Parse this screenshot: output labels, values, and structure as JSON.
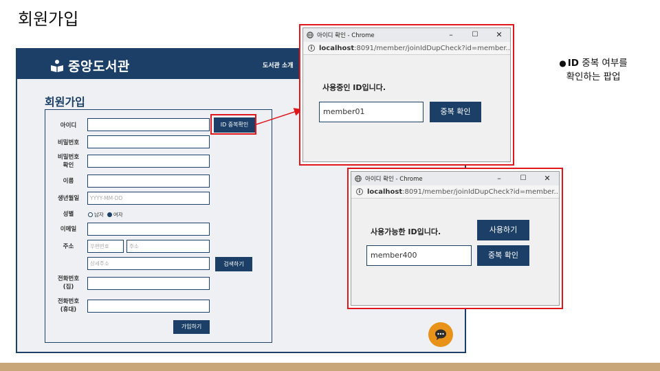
{
  "slide": {
    "title": "회원가입",
    "note_bold": "ID",
    "note_line1": "중복 여부를",
    "note_line2": "확인하는 팝업"
  },
  "site": {
    "logo_text": "중앙도서관",
    "nav_link": "도서관 소개",
    "form_title": "회원가입",
    "fields": {
      "id_label": "아이디",
      "pw_label": "비밀번호",
      "pw_confirm_label_1": "비밀번호",
      "pw_confirm_label_2": "확인",
      "name_label": "이름",
      "birth_label": "생년월일",
      "birth_placeholder": "YYYY-MM-DD",
      "gender_label": "성별",
      "gender_male": "남자",
      "gender_female": "여자",
      "gender_selected": "여자",
      "email_label": "이메일",
      "addr_label": "주소",
      "zip_placeholder": "우편번호",
      "addr_placeholder": "주소",
      "addr_detail_placeholder": "상세주소",
      "tel_home_label_1": "전화번호",
      "tel_home_label_2": "(집)",
      "tel_mobile_label_1": "전화번호",
      "tel_mobile_label_2": "(휴대)"
    },
    "buttons": {
      "dup_check": "ID 중복확인",
      "search": "검색하기",
      "join": "가입하기"
    }
  },
  "popups": [
    {
      "title": "아이디 확인 - Chrome",
      "url_host": "localhost",
      "url_rest": ":8091/member/joinIdDupCheck?id=member...",
      "message": "사용중인 ID입니다.",
      "input_value": "member01",
      "check_button": "중복 확인"
    },
    {
      "title": "아이디 확인 - Chrome",
      "url_host": "localhost",
      "url_rest": ":8091/member/joinIdDupCheck?id=member...",
      "message": "사용가능한 ID입니다.",
      "use_button": "사용하기",
      "input_value": "member400",
      "check_button": "중복 확인"
    }
  ],
  "colors": {
    "brand_navy": "#1b3f66",
    "highlight_red": "#e0161b",
    "chat_orange": "#e8921a",
    "band_tan": "#c9a679"
  },
  "icons": [
    "book-reader-icon",
    "globe-icon",
    "info-icon",
    "minimize-icon",
    "maximize-icon",
    "close-icon",
    "chat-icon"
  ]
}
